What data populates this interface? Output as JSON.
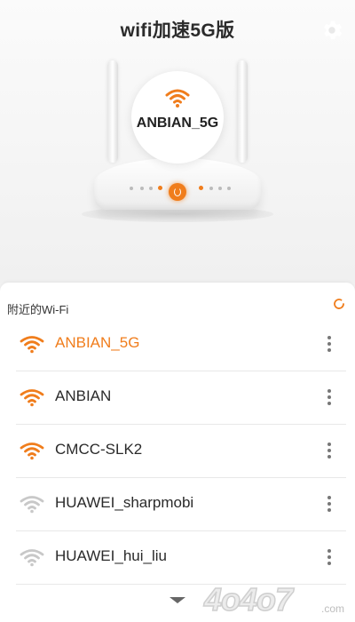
{
  "app": {
    "title": "wifi加速5G版"
  },
  "router": {
    "connected_ssid": "ANBIAN_5G"
  },
  "list": {
    "section_title": "附近的Wi-Fi",
    "networks": [
      {
        "ssid": "ANBIAN_5G",
        "active": true,
        "signal": "strong"
      },
      {
        "ssid": "ANBIAN",
        "active": false,
        "signal": "strong"
      },
      {
        "ssid": "CMCC-SLK2",
        "active": false,
        "signal": "strong"
      },
      {
        "ssid": "HUAWEI_sharpmobi",
        "active": false,
        "signal": "weak"
      },
      {
        "ssid": "HUAWEI_hui_liu",
        "active": false,
        "signal": "weak"
      }
    ]
  },
  "watermark": {
    "brand": "4o4o7",
    "domain": ".com"
  },
  "colors": {
    "accent": "#f07d1c",
    "weak_signal": "#c8c8c8",
    "text": "#2a2a2a"
  },
  "icons": {
    "settings": "gear-icon",
    "refresh": "refresh-icon",
    "wifi": "wifi-icon",
    "more": "more-vertical-icon",
    "expand": "chevron-down-icon"
  }
}
